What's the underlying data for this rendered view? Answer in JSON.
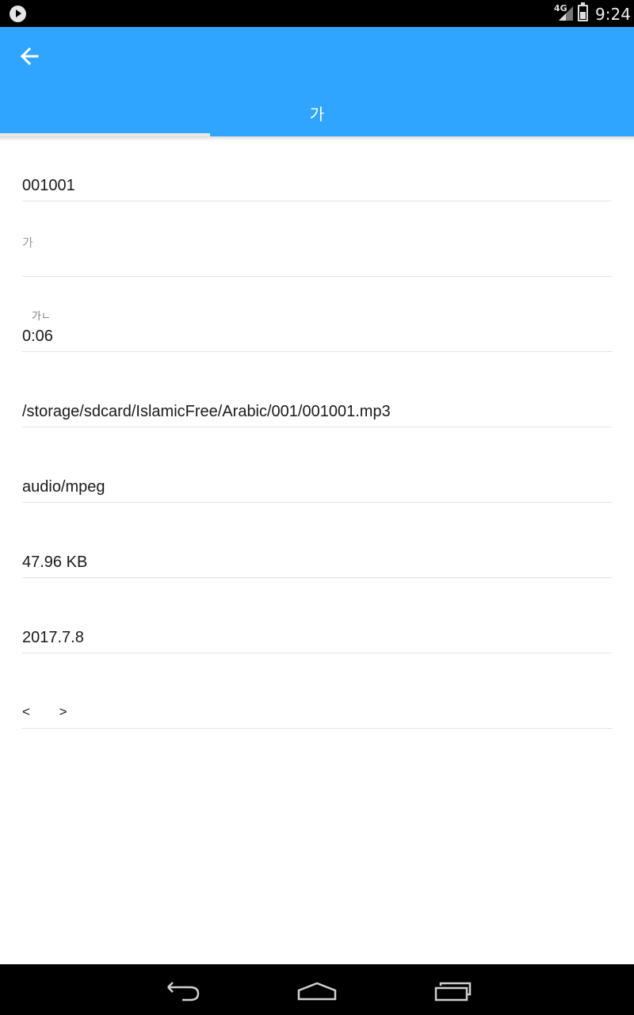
{
  "status_bar": {
    "network": "4G",
    "time": "9:24",
    "icons": [
      "play-notification-icon",
      "signal-icon",
      "battery-icon"
    ]
  },
  "app_bar": {
    "color": "#2fa5ff",
    "tab_label": "가"
  },
  "fields": {
    "title": {
      "value": "001001"
    },
    "hint_field": {
      "placeholder": "가"
    },
    "duration": {
      "label": "가ㄴ",
      "value": "0:06"
    },
    "path": {
      "value": "/storage/sdcard/IslamicFree/Arabic/001/001001.mp3"
    },
    "mime": {
      "value": "audio/mpeg"
    },
    "size": {
      "value": "47.96 KB"
    },
    "date": {
      "value": "2017.7.8"
    },
    "pager": {
      "prev": "<",
      "next": ">"
    }
  },
  "nav_bar": {
    "icons": [
      "back-nav-icon",
      "home-nav-icon",
      "recents-nav-icon"
    ]
  }
}
